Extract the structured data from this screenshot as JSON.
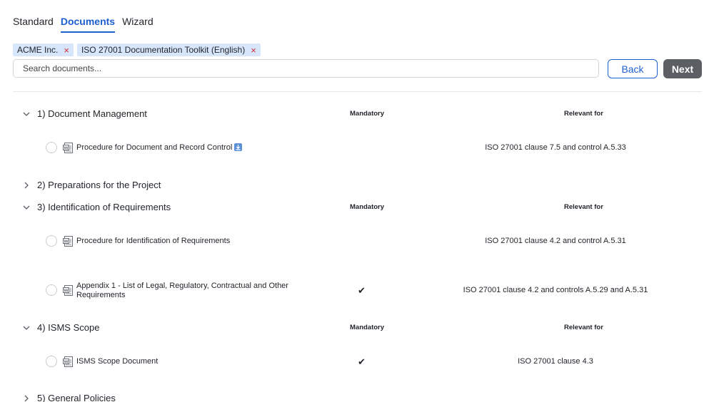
{
  "tabs": [
    {
      "label": "Standard"
    },
    {
      "label": "Documents"
    },
    {
      "label": "Wizard"
    }
  ],
  "chips": [
    {
      "label": "ACME Inc.",
      "remove": "×"
    },
    {
      "label": "ISO 27001 Documentation Toolkit (English)",
      "remove": "×"
    }
  ],
  "search": {
    "placeholder": "Search documents..."
  },
  "buttons": {
    "back": "Back",
    "next": "Next"
  },
  "columns": {
    "mandatory": "Mandatory",
    "relevant": "Relevant for"
  },
  "sections": [
    {
      "title": "1) Document Management",
      "expanded": true,
      "docs": [
        {
          "name": "Procedure for Document and Record Control",
          "mandatory": "",
          "relevant": "ISO 27001 clause 7.5 and control A.5.33",
          "download": true
        }
      ]
    },
    {
      "title": "2) Preparations for the Project",
      "expanded": false
    },
    {
      "title": "3) Identification of Requirements",
      "expanded": true,
      "docs": [
        {
          "name": "Procedure for Identification of Requirements",
          "mandatory": "",
          "relevant": "ISO 27001 clause 4.2 and control A.5.31"
        },
        {
          "name_line1": "Appendix 1 - List of Legal, Regulatory, Contractual and Other",
          "name_line2": "Requirements",
          "mandatory": "✔",
          "relevant": "ISO 27001 clause 4.2 and controls A.5.29 and A.5.31"
        }
      ]
    },
    {
      "title": "4) ISMS Scope",
      "expanded": true,
      "docs": [
        {
          "name": "ISMS Scope Document",
          "mandatory": "✔",
          "relevant": "ISO 27001 clause 4.3"
        }
      ]
    },
    {
      "title": "5) General Policies",
      "expanded": false
    }
  ],
  "icons": {
    "expanded": "chevron-down-icon",
    "collapsed": "chevron-right-icon",
    "doc": "word-document-icon",
    "download": "download-icon"
  },
  "colors": {
    "accent": "#1d5fd1",
    "chip_bg": "#d7e6fb",
    "remove": "#d22d3a",
    "next_bg": "#5b5f63"
  }
}
